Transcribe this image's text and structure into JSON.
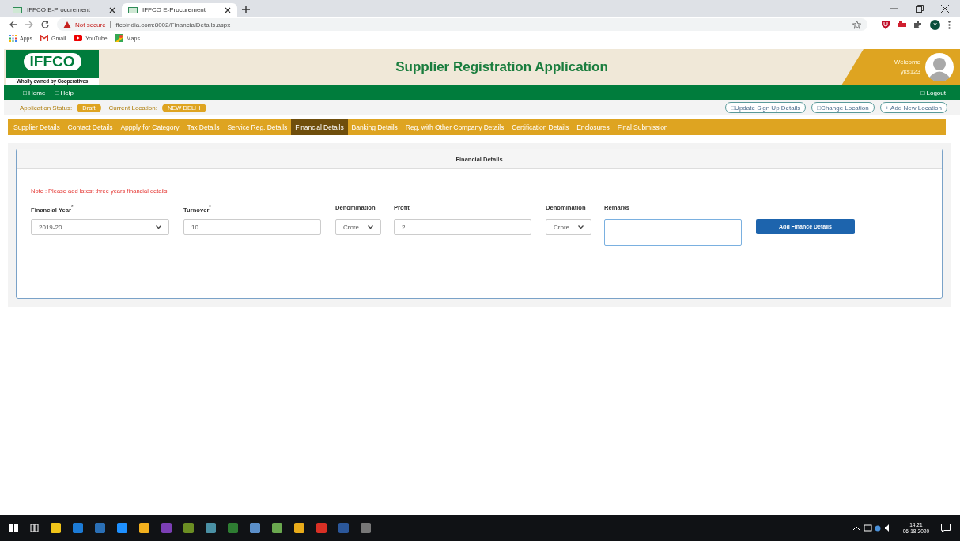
{
  "browser": {
    "tabs": [
      {
        "title": "IFFCO E-Procurement",
        "selected": false
      },
      {
        "title": "IFFCO E-Procurement",
        "selected": true
      }
    ],
    "address": {
      "warning": "Not secure",
      "url": "iffcoindia.com:8002/FinancialDetails.aspx"
    },
    "profile_initial": "Y",
    "bookmarks": [
      {
        "label": "Apps",
        "kind": "apps"
      },
      {
        "label": "Gmail",
        "kind": "gmail"
      },
      {
        "label": "YouTube",
        "kind": "youtube"
      },
      {
        "label": "Maps",
        "kind": "maps"
      }
    ]
  },
  "header": {
    "logo": "IFFCO",
    "tagline": "Wholly owned by Cooperatives",
    "title": "Supplier Registration Application",
    "welcome": "Welcome",
    "username": "yks123"
  },
  "nav": {
    "links": [
      "□ Home",
      "□ Help"
    ],
    "logout": "□ Logout"
  },
  "status": {
    "label": "Application Status:",
    "value": "Draft",
    "location_label": "Current Location:",
    "location": "NEW DELHI",
    "actions": [
      "□Update Sign Up Details",
      "□Change Location",
      "+ Add New Location"
    ]
  },
  "section_tabs": [
    {
      "label": "Supplier Details",
      "selected": false
    },
    {
      "label": "Contact Details",
      "selected": false
    },
    {
      "label": "Appply for Category",
      "selected": false
    },
    {
      "label": "Tax Details",
      "selected": false
    },
    {
      "label": "Service Reg. Details",
      "selected": false
    },
    {
      "label": "Financial Details",
      "selected": true
    },
    {
      "label": "Banking Details",
      "selected": false
    },
    {
      "label": "Reg. with Other Company Details",
      "selected": false
    },
    {
      "label": "Certification Details",
      "selected": false
    },
    {
      "label": "Enclosures",
      "selected": false
    },
    {
      "label": "Final Submission",
      "selected": false
    }
  ],
  "panel": {
    "title": "Financial Details",
    "note": "Note : Please add latest three years financial details",
    "fields": [
      {
        "kind": "select",
        "label": "Financial Year$^{*}$",
        "value": "2019-20"
      },
      {
        "kind": "input",
        "label": "Turnover$^{*}$",
        "value": "10"
      },
      {
        "kind": "select",
        "label": "Denomination",
        "value": "Crore"
      },
      {
        "kind": "input",
        "label": "Profit",
        "value": "2"
      },
      {
        "kind": "select",
        "label": "Denomination",
        "value": "Crore"
      },
      {
        "kind": "textarea",
        "label": "Remarks"
      }
    ],
    "button": "Add Finance Details"
  },
  "taskbar": {
    "time": "14:21",
    "date": "06-18-2020"
  }
}
